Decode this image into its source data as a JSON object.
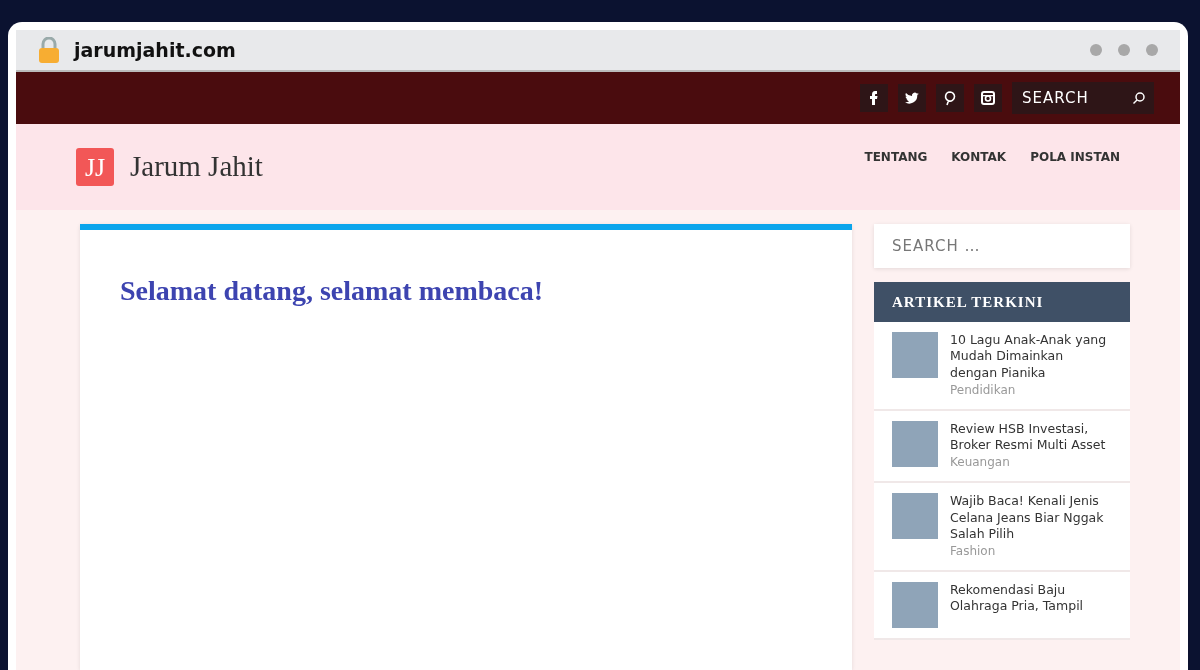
{
  "browser": {
    "url": "jarumjahit.com"
  },
  "topbar": {
    "social": [
      {
        "kind": "facebook"
      },
      {
        "kind": "twitter"
      },
      {
        "kind": "pinterest"
      },
      {
        "kind": "instagram"
      }
    ],
    "search": {
      "placeholder": "SEARCH"
    }
  },
  "header": {
    "logo_mark": "JJ",
    "site_title": "Jarum Jahit",
    "nav": [
      "TENTANG",
      "KONTAK",
      "POLA INSTAN"
    ]
  },
  "main": {
    "heading": "Selamat datang, selamat membaca!"
  },
  "sidebar": {
    "search": {
      "placeholder": "SEARCH …"
    },
    "widget_title": "ARTIKEL TERKINI",
    "articles": [
      {
        "title": "10 Lagu Anak-Anak yang Mudah Dimainkan dengan Pianika",
        "category": "Pendidikan"
      },
      {
        "title": "Review HSB Investasi, Broker Resmi Multi Asset",
        "category": "Keuangan"
      },
      {
        "title": "Wajib Baca! Kenali Jenis Celana Jeans Biar Nggak Salah Pilih",
        "category": "Fashion"
      },
      {
        "title": "Rekomendasi Baju Olahraga Pria, Tampil"
      }
    ]
  }
}
